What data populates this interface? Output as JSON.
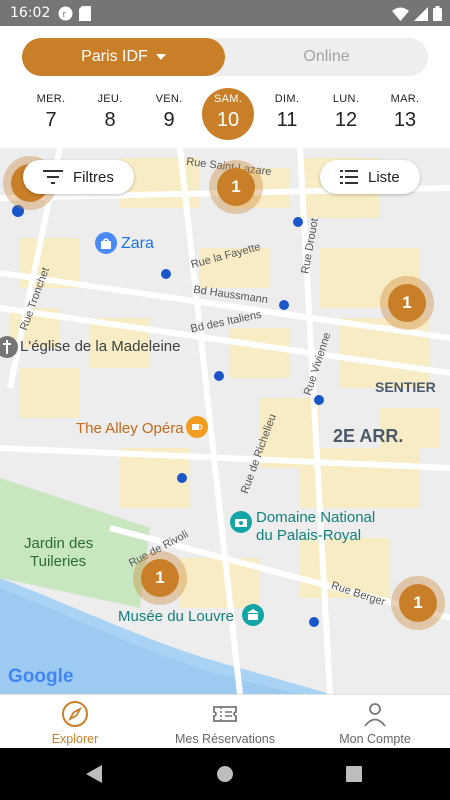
{
  "status_bar": {
    "time": "16:02"
  },
  "region_toggle": {
    "active": "Paris IDF",
    "inactive": "Online"
  },
  "days": [
    {
      "weekday": "MER.",
      "date": "7",
      "selected": false
    },
    {
      "weekday": "JEU.",
      "date": "8",
      "selected": false
    },
    {
      "weekday": "VEN.",
      "date": "9",
      "selected": false
    },
    {
      "weekday": "SAM.",
      "date": "10",
      "selected": true
    },
    {
      "weekday": "DIM.",
      "date": "11",
      "selected": false
    },
    {
      "weekday": "LUN.",
      "date": "12",
      "selected": false
    },
    {
      "weekday": "MAR.",
      "date": "13",
      "selected": false
    }
  ],
  "map": {
    "filters_label": "Filtres",
    "list_label": "Liste",
    "clusters": [
      "1",
      "1",
      "1",
      "1",
      "1"
    ],
    "places": {
      "zara": "Zara",
      "madeleine": "L'église de la Madeleine",
      "alley": "The Alley Opéra",
      "sentier": "SENTIER",
      "arr": "2E ARR.",
      "palais1": "Domaine National",
      "palais2": "du Palais-Royal",
      "tuileries1": "Jardin des",
      "tuileries2": "Tuileries",
      "louvre": "Musée du Louvre",
      "google": "Google"
    },
    "streets": {
      "saint_lazare": "Rue Saint-Lazare",
      "lafayette": "Rue la Fayette",
      "haussmann": "Bd Haussmann",
      "italiens": "Bd des Italiens",
      "drouot": "Rue Drouot",
      "tronchet": "Rue Tronchet",
      "vivienne": "Rue Vivienne",
      "richelieu": "Rue de Richelieu",
      "rivoli": "Rue de Rivoli",
      "berger": "Rue Berger"
    },
    "accent_color": "#c87f27"
  },
  "bottom_nav": [
    {
      "label": "Explorer",
      "icon": "compass-icon",
      "active": true
    },
    {
      "label": "Mes Réservations",
      "icon": "ticket-icon",
      "active": false
    },
    {
      "label": "Mon Compte",
      "icon": "person-icon",
      "active": false
    }
  ]
}
